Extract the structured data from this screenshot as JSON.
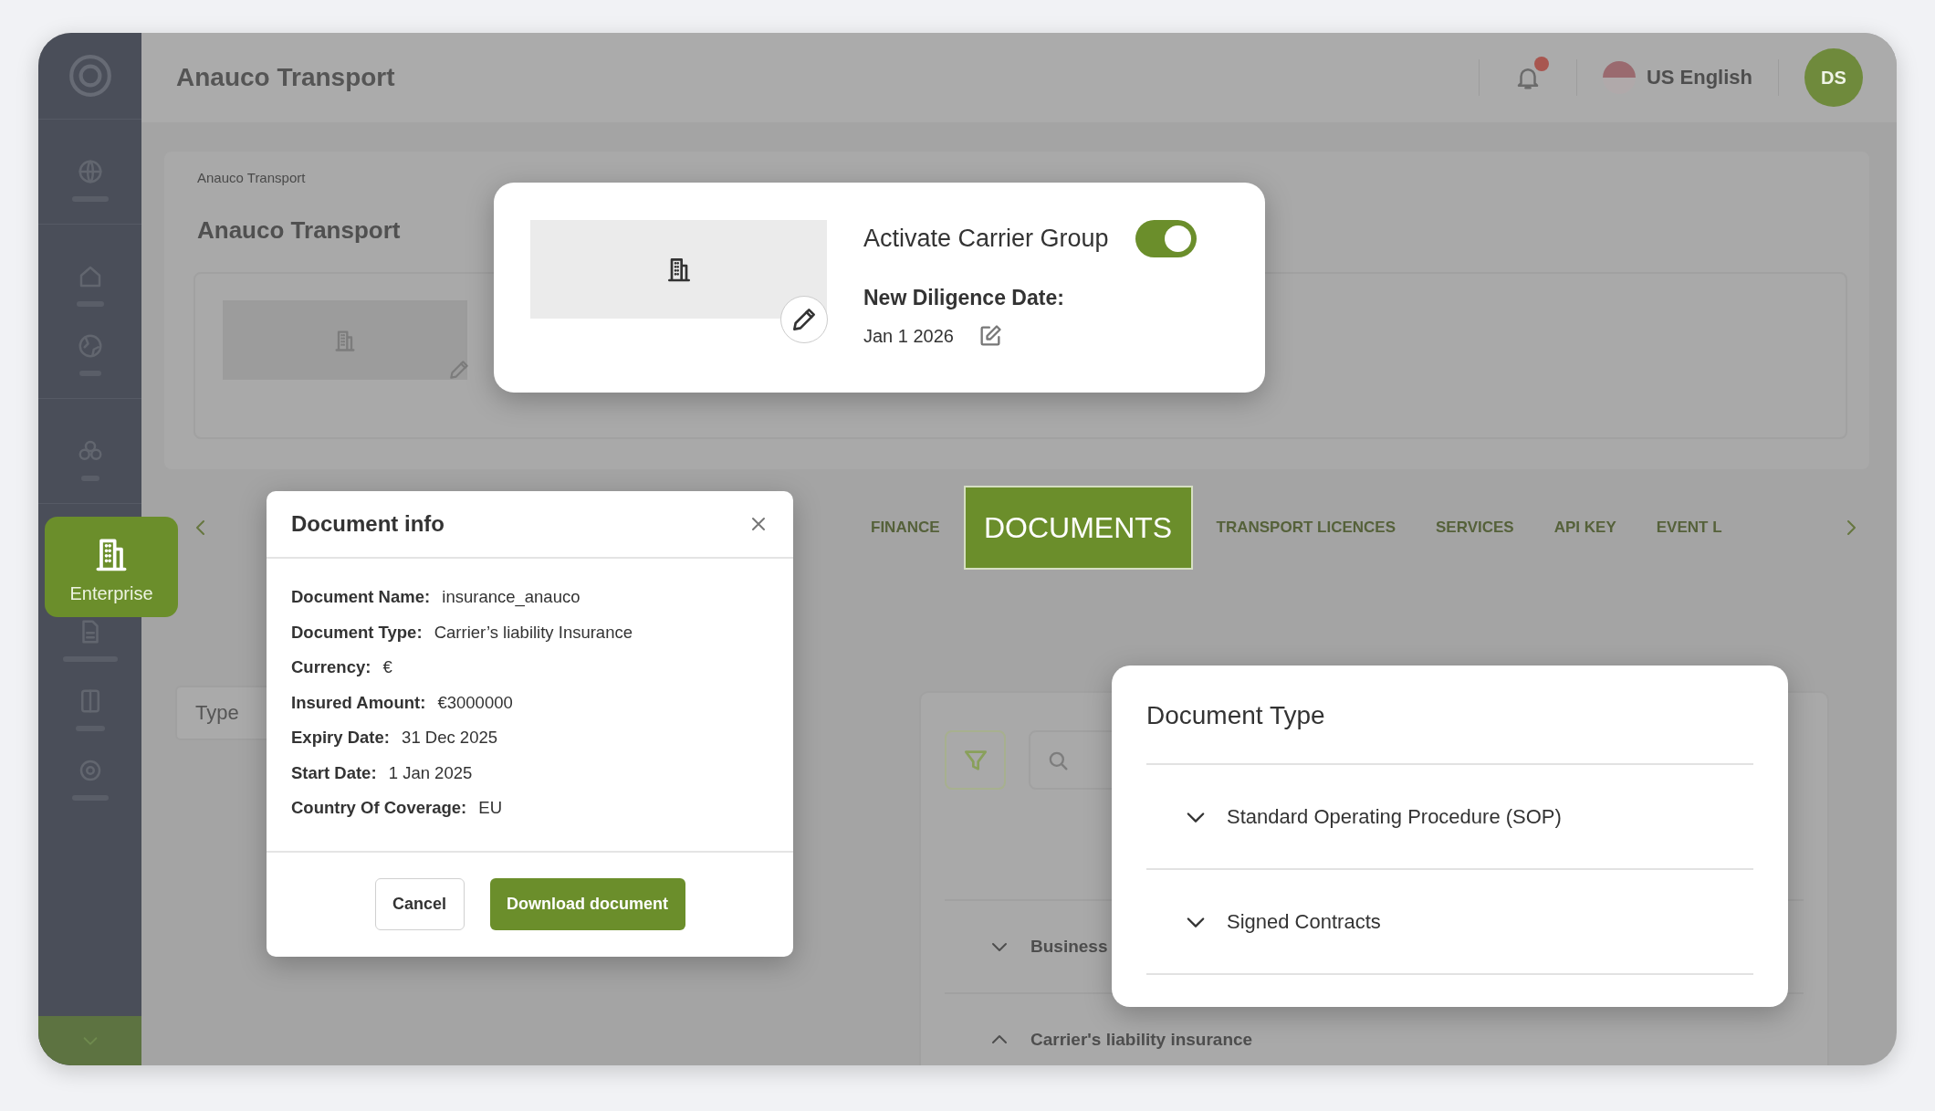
{
  "sidebar": {
    "groups": [
      {
        "items": [
          {
            "selected": false
          }
        ]
      },
      {
        "items": [
          {
            "selected": false
          },
          {
            "selected": false
          }
        ]
      },
      {
        "items": [
          {
            "selected": false
          }
        ]
      },
      {
        "items": [
          {
            "label": "Enterprise",
            "selected": true
          },
          {
            "selected": false
          },
          {
            "selected": false
          },
          {
            "selected": false
          }
        ]
      }
    ]
  },
  "header": {
    "title": "Anauco Transport",
    "language": "US English",
    "avatar": "DS"
  },
  "company": {
    "breadcrumb": "Anauco Transport",
    "title": "Anauco Transport"
  },
  "carrier_group": {
    "label": "Activate Carrier Group",
    "on": true,
    "date_label": "New Diligence Date:",
    "date": "Jan 1 2026"
  },
  "tabs": [
    {
      "label": "FINANCE",
      "selected": false
    },
    {
      "label": "DOCUMENTS",
      "selected": true
    },
    {
      "label": "TRANSPORT LICENCES",
      "selected": false
    },
    {
      "label": "SERVICES",
      "selected": false
    },
    {
      "label": "API KEY",
      "selected": false
    },
    {
      "label": "EVENT L",
      "selected": false
    }
  ],
  "type_filter": {
    "placeholder": "Type"
  },
  "document_list": {
    "rows": [
      {
        "label": "Business",
        "expanded": false
      },
      {
        "label": "Carrier's liability insurance",
        "expanded": true
      }
    ]
  },
  "document_info": {
    "title": "Document info",
    "fields": [
      {
        "label": "Document Name:",
        "value": "insurance_anauco"
      },
      {
        "label": "Document Type:",
        "value": "Carrier’s liability Insurance"
      },
      {
        "label": "Currency:",
        "value": "€"
      },
      {
        "label": "Insured Amount:",
        "value": "€3000000"
      },
      {
        "label": "Expiry Date:",
        "value": "31 Dec 2025"
      },
      {
        "label": "Start Date:",
        "value": "1 Jan 2025"
      },
      {
        "label": "Country Of Coverage:",
        "value": "EU"
      }
    ],
    "buttons": [
      {
        "label": "Cancel",
        "kind": "secondary"
      },
      {
        "label": "Download document",
        "kind": "primary"
      }
    ]
  },
  "document_type": {
    "title": "Document Type",
    "items": [
      {
        "label": "Standard Operating Procedure (SOP)",
        "expanded": false
      },
      {
        "label": "Signed Contracts",
        "expanded": false
      }
    ]
  }
}
